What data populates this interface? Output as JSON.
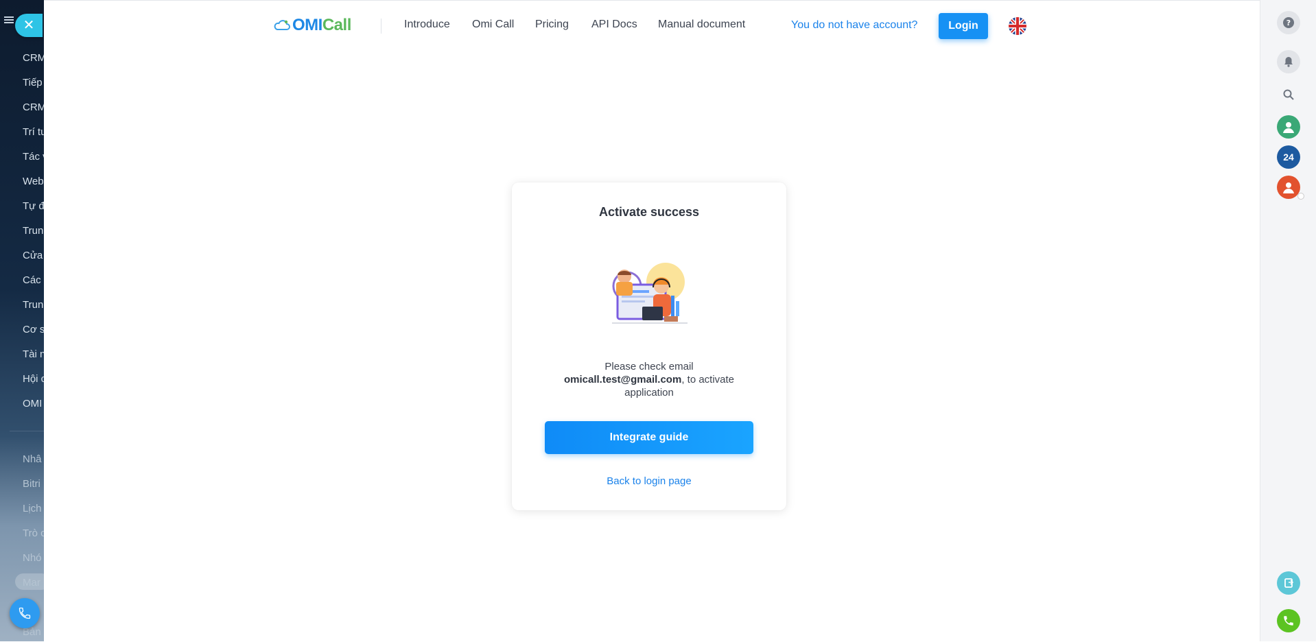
{
  "sidebar": {
    "items": [
      "CRM",
      "Tiếp",
      "CRM",
      "Trí tu",
      "Tác v",
      "Web",
      "Tự đ",
      "Trun",
      "Cửa",
      "Các s",
      "Trun",
      "Cơ s",
      "Tài n",
      "Hội c",
      "OMI"
    ],
    "lower_items": [
      "Nhâ",
      "Bitri",
      "Lịch",
      "Trò c",
      "Nhó",
      "Mar",
      "Bản"
    ]
  },
  "navbar": {
    "logo_text_o": "O",
    "logo_text_mi": "MI",
    "logo_text_call": "Call",
    "links": [
      "Introduce",
      "Omi Call",
      "Pricing",
      "API Docs",
      "Manual document"
    ],
    "signup_link": "You do not have account?",
    "login_label": "Login",
    "language_flag": "uk-flag-icon"
  },
  "card": {
    "title": "Activate success",
    "message_prefix": "Please check email",
    "email": "omicall.test@gmail.com",
    "message_suffix": ", to activate application",
    "guide_button": "Integrate guide",
    "back_link": "Back to login page"
  },
  "right_rail": {
    "counter": "24",
    "icons": [
      "help-icon",
      "bell-icon",
      "search-icon",
      "user-avatar-icon",
      "counter-badge",
      "user-avatar-icon",
      "document-icon",
      "phone-icon"
    ]
  },
  "colors": {
    "primary": "#1691f4",
    "link": "#1a82ea",
    "logo_green": "#5cb85c"
  }
}
